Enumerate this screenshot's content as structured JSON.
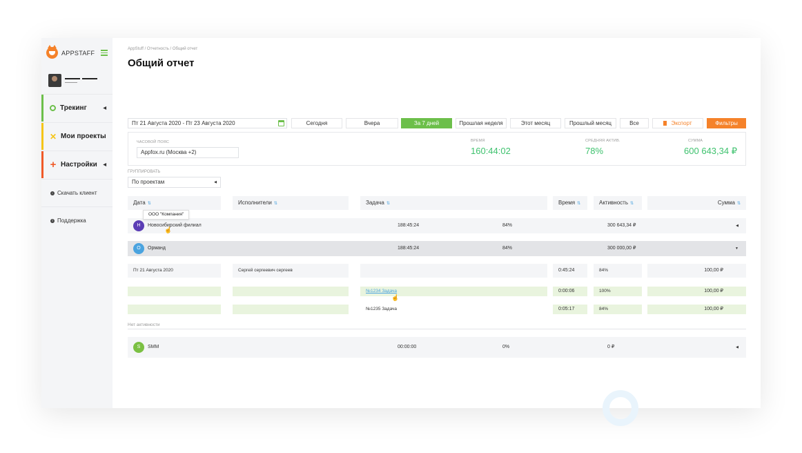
{
  "brand": {
    "name": "APPSTAFF"
  },
  "nav": [
    {
      "label": "Трекинг",
      "icon": "circle-icon",
      "color": "#6cbf4a"
    },
    {
      "label": "Мои проекты",
      "icon": "cross-icon",
      "color": "#f5c518"
    },
    {
      "label": "Настройки",
      "icon": "plus-icon",
      "color": "#f05a28"
    }
  ],
  "nav_small": [
    {
      "label": "Скачать клиент"
    },
    {
      "label": "Поддержка"
    }
  ],
  "breadcrumbs": "AppStuff / Отчетность / Общий отчет",
  "page_title": "Общий отчет",
  "date_range": "Пт 21 Августа 2020 - Пт 23 Августа 2020",
  "periods": [
    "Сегодня",
    "Вчера",
    "За 7 дней",
    "Прошлая неделя",
    "Этот месяц",
    "Прошлый месяц",
    "Все"
  ],
  "export_label": "Экспорт",
  "filters_label": "Фильтры",
  "stats": {
    "timezone_label": "ЧАСОВОЙ ПОЯС",
    "timezone_value": "Appfox.ru (Москва +2)",
    "time_label": "ВРЕМЯ",
    "time_value": "160:44:02",
    "activity_label": "СРЕДНЯЯ АКТИВ.",
    "activity_value": "78%",
    "sum_label": "СУММА",
    "sum_value": "600 643,34 ₽"
  },
  "group_label": "ГРУППИРОВАТЬ",
  "group_value": "По проектам",
  "columns": [
    "Дата",
    "Исполнители",
    "Задача",
    "Время",
    "Активность",
    "Сумма"
  ],
  "tooltip": "ООО \"Компания\"",
  "groups": [
    {
      "initial": "Н",
      "name": "Новосибирский филиал",
      "time": "188:45:24",
      "activity": "84%",
      "sum": "300 643,34 ₽",
      "color": "#5b3db5"
    },
    {
      "initial": "О",
      "name": "Орманд",
      "time": "188:45:24",
      "activity": "84%",
      "sum": "300 000,00 ₽",
      "color": "#4aa3df"
    }
  ],
  "rows": [
    {
      "date": "Пт 21 Августа 2020",
      "executor": "Сергей сергеевич сергеев",
      "task": "",
      "time": "0:45:24",
      "activity": "84%",
      "sum": "100,00 ₽"
    },
    {
      "date": "",
      "executor": "",
      "task": "№1234 Задача",
      "time": "0:00:06",
      "activity": "100%",
      "sum": "100,00 ₽"
    },
    {
      "date": "",
      "executor": "",
      "task": "№1235 Задача",
      "time": "0:05:17",
      "activity": "84%",
      "sum": "100,00 ₽"
    }
  ],
  "no_activity_label": "Нет активности",
  "inactive_group": {
    "initial": "S",
    "name": "SMM",
    "time": "00:00:00",
    "activity": "0%",
    "sum": "0 ₽",
    "color": "#7bc043"
  }
}
